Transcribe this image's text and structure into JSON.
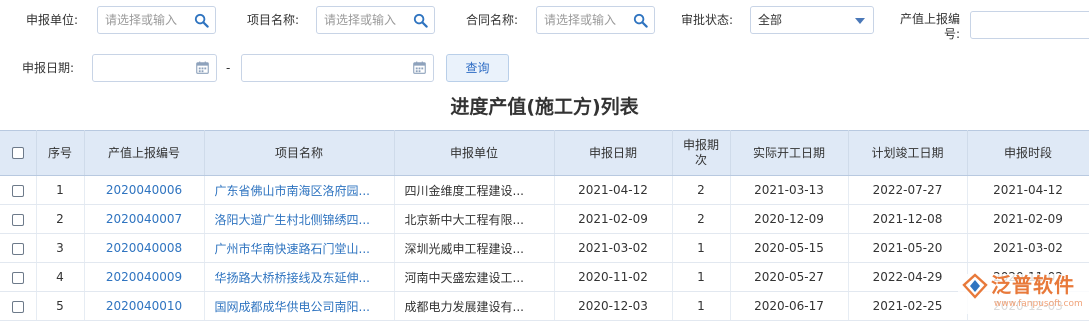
{
  "filters": {
    "unit": {
      "label": "申报单位:",
      "placeholder": "请选择或输入"
    },
    "project": {
      "label": "项目名称:",
      "placeholder": "请选择或输入"
    },
    "contract": {
      "label": "合同名称:",
      "placeholder": "请选择或输入"
    },
    "status": {
      "label": "审批状态:",
      "value": "全部"
    },
    "report_no": {
      "label_line1": "产值上报编",
      "label_line2": "号:"
    },
    "date": {
      "label": "申报日期:",
      "separator": "-"
    },
    "query_label": "查询"
  },
  "title": "进度产值(施工方)列表",
  "table": {
    "headers": {
      "seq": "序号",
      "report_no": "产值上报编号",
      "project": "项目名称",
      "unit": "申报单位",
      "date": "申报日期",
      "period_l1": "申报期",
      "period_l2": "次",
      "start": "实际开工日期",
      "end": "计划竣工日期",
      "time": "申报时段"
    },
    "rows": [
      {
        "seq": "1",
        "report_no": "2020040006",
        "project": "广东省佛山市南海区洛府园...",
        "unit": "四川金维度工程建设...",
        "date": "2021-04-12",
        "period": "2",
        "start": "2021-03-13",
        "end": "2022-07-27",
        "time": "2021-04-12"
      },
      {
        "seq": "2",
        "report_no": "2020040007",
        "project": "洛阳大道广生村北侧锦绣四...",
        "unit": "北京新中大工程有限...",
        "date": "2021-02-09",
        "period": "2",
        "start": "2020-12-09",
        "end": "2021-12-08",
        "time": "2021-02-09"
      },
      {
        "seq": "3",
        "report_no": "2020040008",
        "project": "广州市华南快速路石门堂山...",
        "unit": "深圳光威申工程建设...",
        "date": "2021-03-02",
        "period": "1",
        "start": "2020-05-15",
        "end": "2021-05-20",
        "time": "2021-03-02"
      },
      {
        "seq": "4",
        "report_no": "2020040009",
        "project": "华扬路大桥桥接线及东延伸...",
        "unit": "河南中天盛宏建设工...",
        "date": "2020-11-02",
        "period": "1",
        "start": "2020-05-27",
        "end": "2022-04-29",
        "time": "2020-11-02"
      },
      {
        "seq": "5",
        "report_no": "2020040010",
        "project": "国网成都成华供电公司南阳...",
        "unit": "成都电力发展建设有...",
        "date": "2020-12-03",
        "period": "1",
        "start": "2020-06-17",
        "end": "2021-02-25",
        "time": "2020-12-03"
      }
    ]
  },
  "watermark": {
    "brand": "泛普软件",
    "url": "www.fanpusoft.com"
  },
  "colors": {
    "accent": "#2f74c0",
    "header_bg": "#dfe9f6",
    "orange": "#e8793a"
  },
  "icons": {
    "search": "search-icon",
    "calendar": "calendar-icon",
    "dropdown": "dropdown-arrow-icon"
  }
}
